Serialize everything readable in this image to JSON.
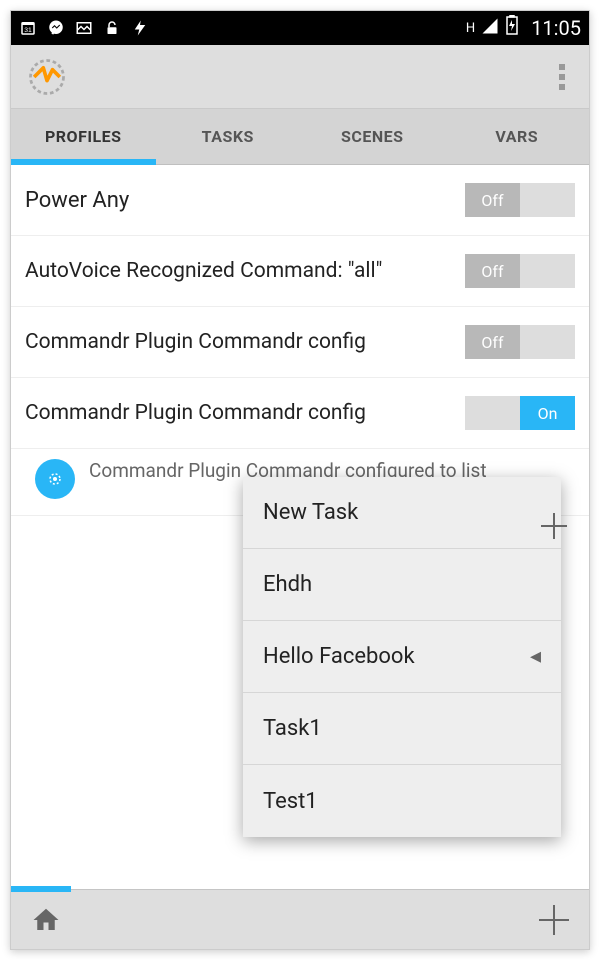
{
  "status": {
    "time": "11:05",
    "signal_label": "H"
  },
  "tabs": [
    {
      "label": "PROFILES",
      "active": true
    },
    {
      "label": "TASKS",
      "active": false
    },
    {
      "label": "SCENES",
      "active": false
    },
    {
      "label": "VARS",
      "active": false
    }
  ],
  "profiles": [
    {
      "label": "Power Any",
      "state": "Off",
      "on": false
    },
    {
      "label": "AutoVoice Recognized Command: \"all\"",
      "state": "Off",
      "on": false
    },
    {
      "label": "Commandr Plugin Commandr config",
      "state": "Off",
      "on": false
    },
    {
      "label": "Commandr Plugin Commandr config",
      "state": "On",
      "on": true
    }
  ],
  "profile_detail": {
    "text": "Commandr Plugin Commandr configured to list"
  },
  "popup": {
    "items": [
      {
        "label": "New Task",
        "trailing": "plus"
      },
      {
        "label": "Ehdh",
        "trailing": null
      },
      {
        "label": "Hello Facebook",
        "trailing": "left-arrow"
      },
      {
        "label": "Task1",
        "trailing": null
      },
      {
        "label": "Test1",
        "trailing": null
      }
    ]
  }
}
